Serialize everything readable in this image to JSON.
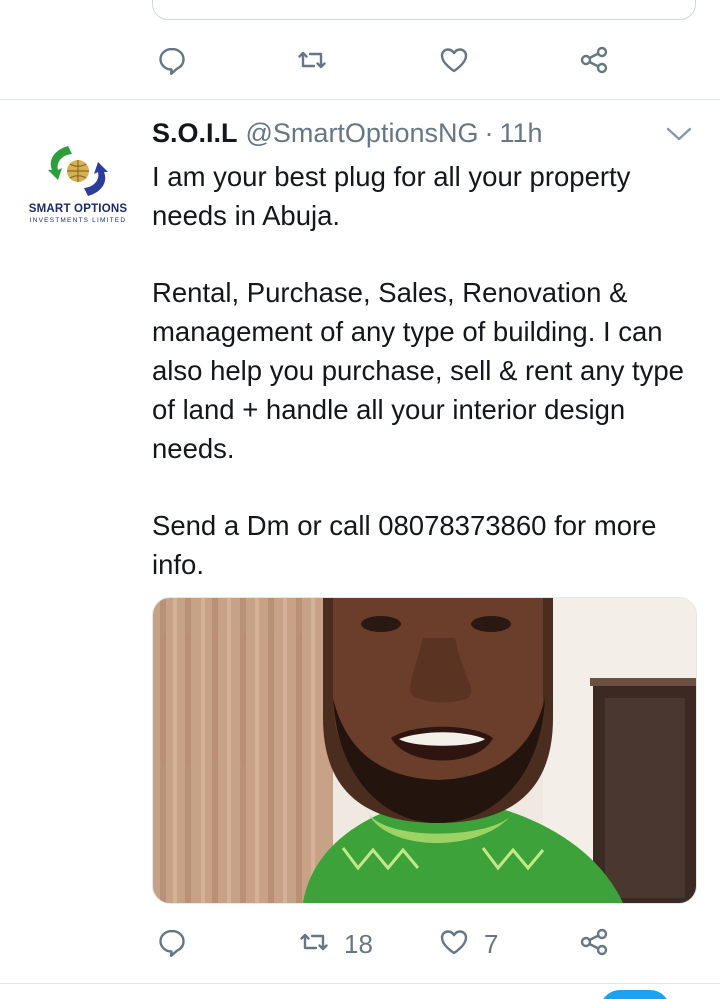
{
  "prev_tweet": {
    "actions": {
      "reply_icon": "reply-icon",
      "retweet_icon": "retweet-icon",
      "like_icon": "heart-icon",
      "share_icon": "share-icon"
    }
  },
  "tweet": {
    "display_name": "S.O.I.L",
    "handle": "@SmartOptionsNG",
    "separator": "·",
    "time": "11h",
    "avatar": {
      "logo_text": "SMART OPTIONS",
      "logo_subtext": "INVESTMENTS LIMITED"
    },
    "text": "I am your best plug for all your property needs in Abuja.\n\nRental, Purchase, Sales, Renovation & management of any type of building. I can also help you purchase, sell & rent any type of land + handle all your interior design needs.\n\nSend a Dm or call 08078373860 for more info.",
    "media_description": "photo",
    "actions": {
      "reply_count": "",
      "retweet_count": "18",
      "like_count": "7"
    }
  },
  "colors": {
    "text": "#14171a",
    "muted": "#657786",
    "divider": "#e1e8ed",
    "accent": "#1da1f2"
  }
}
